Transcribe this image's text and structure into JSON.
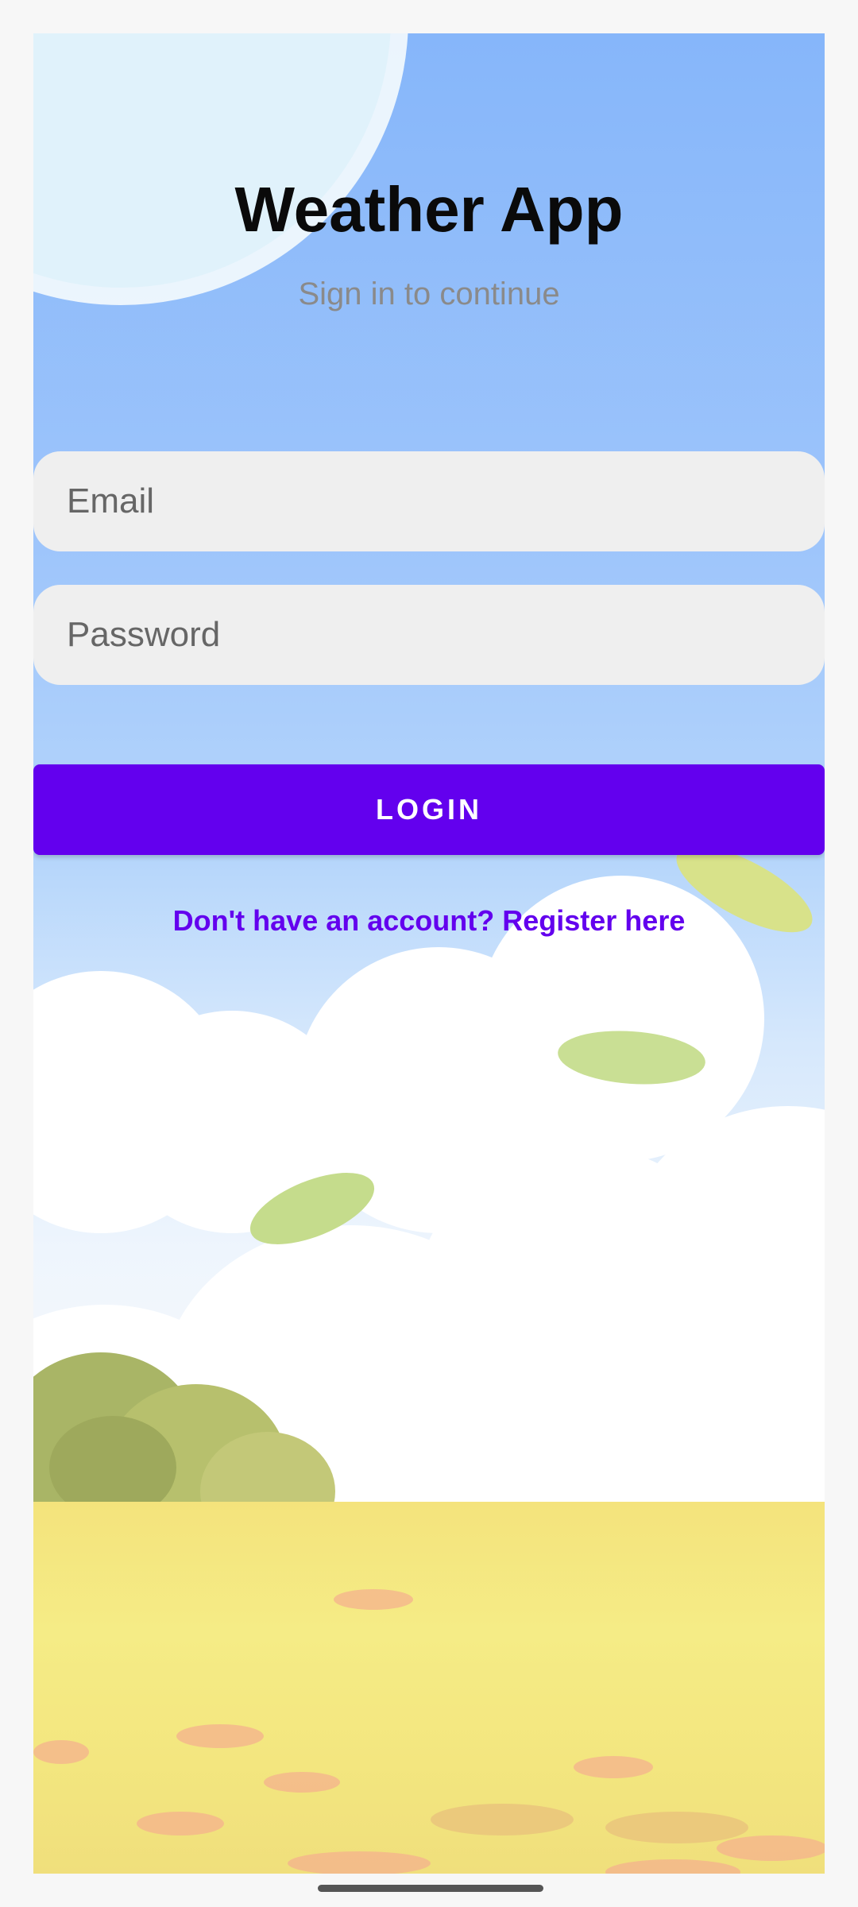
{
  "app": {
    "title": "Weather App",
    "subtitle": "Sign in to continue"
  },
  "form": {
    "email_placeholder": "Email",
    "password_placeholder": "Password",
    "login_label": "LOGIN",
    "register_link": "Don't have an account? Register here"
  },
  "colors": {
    "accent": "#6300ee",
    "field_background": "#efefef",
    "sky_top": "#86b6fa",
    "ground": "#f4e37c"
  }
}
